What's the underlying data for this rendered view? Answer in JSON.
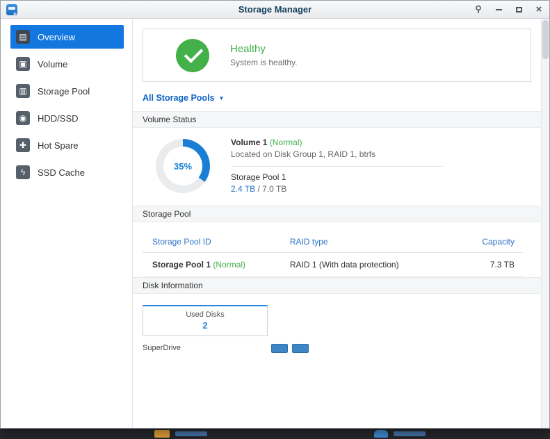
{
  "window": {
    "title": "Storage Manager",
    "controls": [
      {
        "name": "pin-icon"
      },
      {
        "name": "minimize-icon"
      },
      {
        "name": "maximize-icon"
      },
      {
        "name": "close-icon",
        "glyph": "×"
      }
    ]
  },
  "sidebar": {
    "items": [
      {
        "label": "Overview",
        "icon": "overview-icon",
        "glyph": "▤",
        "selected": true
      },
      {
        "label": "Volume",
        "icon": "volume-icon",
        "glyph": "▣",
        "selected": false
      },
      {
        "label": "Storage Pool",
        "icon": "storage-pool-icon",
        "glyph": "▥",
        "selected": false
      },
      {
        "label": "HDD/SSD",
        "icon": "hdd-ssd-icon",
        "glyph": "◉",
        "selected": false
      },
      {
        "label": "Hot Spare",
        "icon": "hot-spare-icon",
        "glyph": "✚",
        "selected": false
      },
      {
        "label": "SSD Cache",
        "icon": "ssd-cache-icon",
        "glyph": "ϟ",
        "selected": false
      }
    ]
  },
  "health": {
    "status": "Healthy",
    "message": "System is healthy."
  },
  "pool_filter": {
    "label": "All Storage Pools"
  },
  "sections": {
    "volume_status": "Volume Status",
    "storage_pool": "Storage Pool",
    "disk_information": "Disk Information"
  },
  "volume": {
    "percent": 35,
    "percent_label": "35%",
    "name": "Volume 1",
    "status": "(Normal)",
    "description": "Located on Disk Group 1, RAID 1, btrfs",
    "pool_name": "Storage Pool 1",
    "used": "2.4 TB",
    "capacity_rest": " / 7.0 TB"
  },
  "pool_table": {
    "headers": [
      "Storage Pool ID",
      "RAID type",
      "Capacity"
    ],
    "rows": [
      {
        "id": "Storage Pool 1",
        "status": "(Normal)",
        "raid_type": "RAID 1 (With data protection)",
        "capacity": "7.3 TB"
      }
    ]
  },
  "disk_info": {
    "used_disks_label": "Used Disks",
    "used_disks_count": "2",
    "device_name": "SuperDrive",
    "slot_count": 2
  },
  "colors": {
    "accent_blue": "#1a7fd4",
    "link_blue": "#2a72c8",
    "status_green": "#43b049",
    "sidebar_selected": "#1377e0",
    "donut_track": "#e9ebed"
  }
}
